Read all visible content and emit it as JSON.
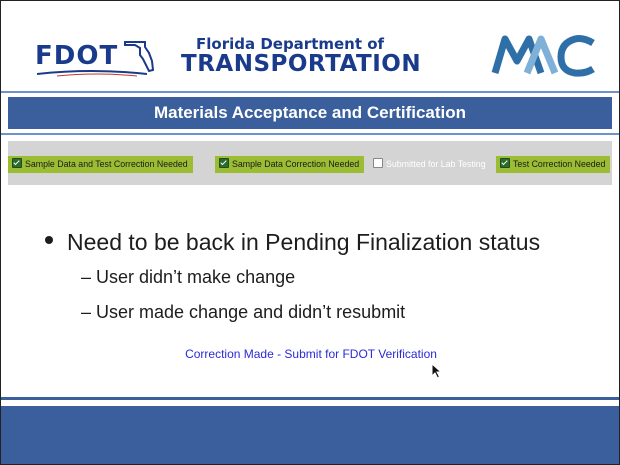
{
  "header": {
    "fdot_logo_text": "FDOT",
    "department_line1": "Florida Department of",
    "department_line2": "TRANSPORTATION",
    "mac_logo_text": "MAC"
  },
  "title_bar": "Materials Acceptance and Certification",
  "checkboxes": [
    {
      "label": "Sample Data and Test Correction Needed",
      "checked": true
    },
    {
      "label": "Sample Data Correction Needed",
      "checked": true
    },
    {
      "label": "Submitted for Lab Testing",
      "checked": false
    },
    {
      "label": "Test Correction Needed",
      "checked": true
    }
  ],
  "content": {
    "bullet": "Need to be back in Pending Finalization status",
    "sub_items": [
      "– User didn’t make change",
      "– User made change and didn’t resubmit"
    ],
    "link": "Correction Made - Submit for FDOT Verification"
  },
  "colors": {
    "brand_blue": "#3a5f9c",
    "checked_green": "#9cbd33",
    "link_blue": "#2a2ad6"
  }
}
